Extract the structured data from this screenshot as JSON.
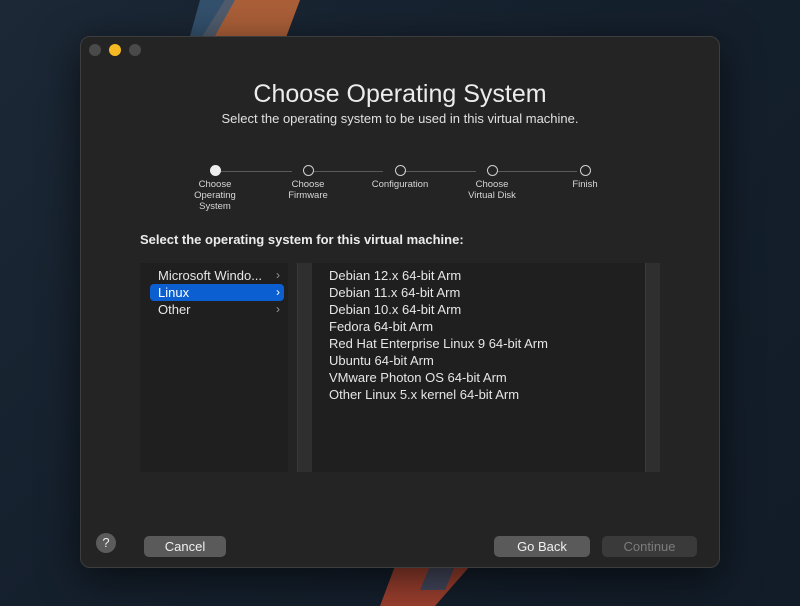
{
  "window": {
    "title": "Choose Operating System",
    "subtitle": "Select the operating system to be used in this virtual machine."
  },
  "steps": [
    {
      "label": "Choose Operating System",
      "active": true
    },
    {
      "label": "Choose Firmware",
      "active": false
    },
    {
      "label": "Configuration",
      "active": false
    },
    {
      "label": "Choose Virtual Disk",
      "active": false
    },
    {
      "label": "Finish",
      "active": false
    }
  ],
  "prompt": "Select the operating system for this virtual machine:",
  "os_families": [
    {
      "label": "Microsoft Windo...",
      "chevron": "›",
      "selected": false
    },
    {
      "label": "Linux",
      "chevron": "›",
      "selected": true
    },
    {
      "label": "Other",
      "chevron": "›",
      "selected": false
    }
  ],
  "distributions": [
    "Debian 12.x 64-bit Arm",
    "Debian 11.x 64-bit Arm",
    "Debian 10.x 64-bit Arm",
    "Fedora 64-bit Arm",
    "Red Hat Enterprise Linux 9 64-bit Arm",
    "Ubuntu 64-bit Arm",
    "VMware Photon OS 64-bit Arm",
    "Other Linux 5.x kernel 64-bit Arm"
  ],
  "buttons": {
    "help": "?",
    "cancel": "Cancel",
    "go_back": "Go Back",
    "continue": "Continue",
    "continue_enabled": false
  },
  "colors": {
    "selection_accent": "#0b5fd0",
    "minimize_light": "#f5b923"
  }
}
